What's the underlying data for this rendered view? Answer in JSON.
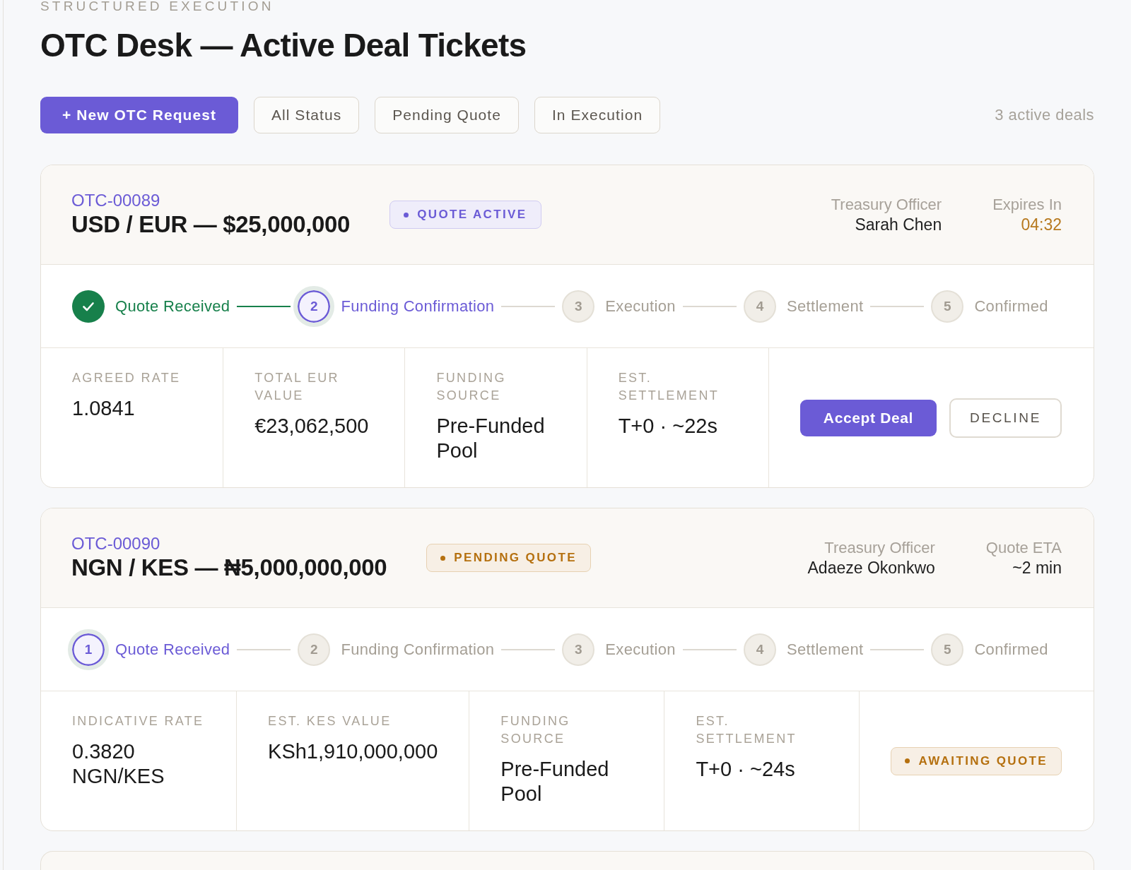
{
  "header": {
    "eyebrow": "STRUCTURED EXECUTION",
    "title": "OTC Desk — Active Deal Tickets"
  },
  "toolbar": {
    "new_button": "+ New OTC Request",
    "filters": [
      {
        "label": "All Status",
        "selected": false
      },
      {
        "label": "Pending Quote",
        "selected": false
      },
      {
        "label": "In Execution",
        "selected": false
      }
    ],
    "count": "3 active deals"
  },
  "deals": [
    {
      "id": "OTC-00089",
      "title": "USD / EUR — $25,000,000",
      "badge": {
        "label": "QUOTE ACTIVE",
        "color": "#6b5bd6"
      },
      "info": [
        {
          "label": "Treasury Officer",
          "value": "Sarah Chen",
          "highlight": false
        },
        {
          "label": "Expires In",
          "value": "04:32",
          "highlight": true
        }
      ],
      "steps": [
        {
          "label": "Quote Received",
          "completed": true,
          "current": false
        },
        {
          "number": "2",
          "label": "Funding Confirmation",
          "completed": false,
          "current": true
        },
        {
          "number": "3",
          "label": "Execution",
          "completed": false,
          "current": false
        },
        {
          "number": "4",
          "label": "Settlement",
          "completed": false,
          "current": false
        },
        {
          "number": "5",
          "label": "Confirmed",
          "completed": false,
          "current": false
        }
      ],
      "details": [
        {
          "label": "AGREED RATE",
          "value": "1.0841"
        },
        {
          "label": "TOTAL EUR VALUE",
          "value": "€23,062,500"
        },
        {
          "label": "FUNDING SOURCE",
          "value": "Pre-Funded Pool"
        },
        {
          "label": "EST. SETTLEMENT",
          "value": "T+0 · ~22s"
        }
      ],
      "actions": {
        "buttons": [
          {
            "kind": "accept",
            "label": "Accept Deal"
          },
          {
            "kind": "decline",
            "label": "DECLINE"
          }
        ]
      }
    },
    {
      "id": "OTC-00090",
      "title": "NGN / KES — ₦5,000,000,000",
      "badge": {
        "label": "PENDING QUOTE",
        "color": "#b5700f"
      },
      "info": [
        {
          "label": "Treasury Officer",
          "value": "Adaeze Okonkwo",
          "highlight": false
        },
        {
          "label": "Quote ETA",
          "value": "~2 min",
          "highlight": false
        }
      ],
      "steps": [
        {
          "number": "1",
          "label": "Quote Received",
          "completed": false,
          "current": true
        },
        {
          "number": "2",
          "label": "Funding Confirmation",
          "completed": false,
          "current": false
        },
        {
          "number": "3",
          "label": "Execution",
          "completed": false,
          "current": false
        },
        {
          "number": "4",
          "label": "Settlement",
          "completed": false,
          "current": false
        },
        {
          "number": "5",
          "label": "Confirmed",
          "completed": false,
          "current": false
        }
      ],
      "details": [
        {
          "label": "INDICATIVE RATE",
          "value": "0.3820 NGN/KES"
        },
        {
          "label": "EST. KES VALUE",
          "value": "KSh1,910,000,000"
        },
        {
          "label": "FUNDING SOURCE",
          "value": "Pre-Funded Pool"
        },
        {
          "label": "EST. SETTLEMENT",
          "value": "T+0 · ~24s"
        }
      ],
      "actions": {
        "badge": {
          "label": "AWAITING QUOTE",
          "color": "#b5700f"
        }
      }
    }
  ]
}
